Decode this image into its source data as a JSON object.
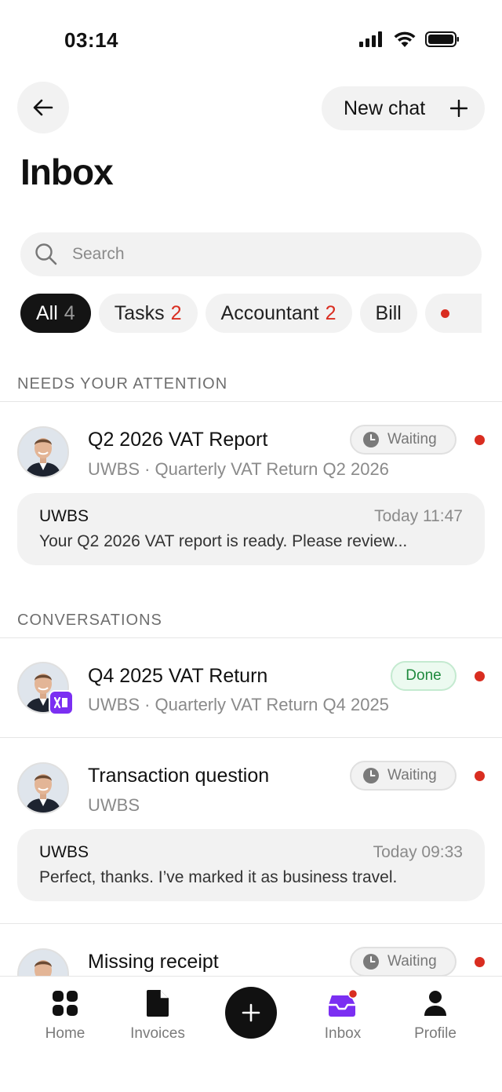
{
  "status_bar": {
    "time": "03:14"
  },
  "header": {
    "new_chat_label": "New chat",
    "title": "Inbox"
  },
  "search": {
    "placeholder": "Search"
  },
  "filters": [
    {
      "label": "All",
      "count": "4",
      "active": true
    },
    {
      "label": "Tasks",
      "count": "2"
    },
    {
      "label": "Accountant",
      "count": "2"
    },
    {
      "label": "Bill",
      "count": ""
    }
  ],
  "sections": {
    "attention_label": "NEEDS YOUR ATTENTION",
    "conversations_label": "CONVERSATIONS"
  },
  "attention_items": [
    {
      "title": "Q2 2026 VAT Report",
      "subtitle": "UWBS · Quarterly VAT Return Q2 2026",
      "status": "Waiting",
      "preview": {
        "sender": "UWBS",
        "time": "Today 11:47",
        "text": "Your Q2 2026 VAT report is ready. Please review..."
      }
    }
  ],
  "conversations": [
    {
      "title": "Q4 2025 VAT Return",
      "subtitle": "UWBS · Quarterly VAT Return Q4 2025",
      "status": "Done"
    },
    {
      "title": "Transaction question",
      "subtitle": "UWBS",
      "status": "Waiting",
      "preview": {
        "sender": "UWBS",
        "time": "Today 09:33",
        "text": "Perfect, thanks. I’ve marked it as business travel."
      }
    },
    {
      "title": "Missing receipt",
      "status": "Waiting"
    }
  ],
  "tabbar": {
    "home": "Home",
    "invoices": "Invoices",
    "inbox": "Inbox",
    "profile": "Profile"
  },
  "colors": {
    "accent": "#7b2ff2",
    "unread": "#d92d20",
    "done": "#1f8a3e"
  }
}
